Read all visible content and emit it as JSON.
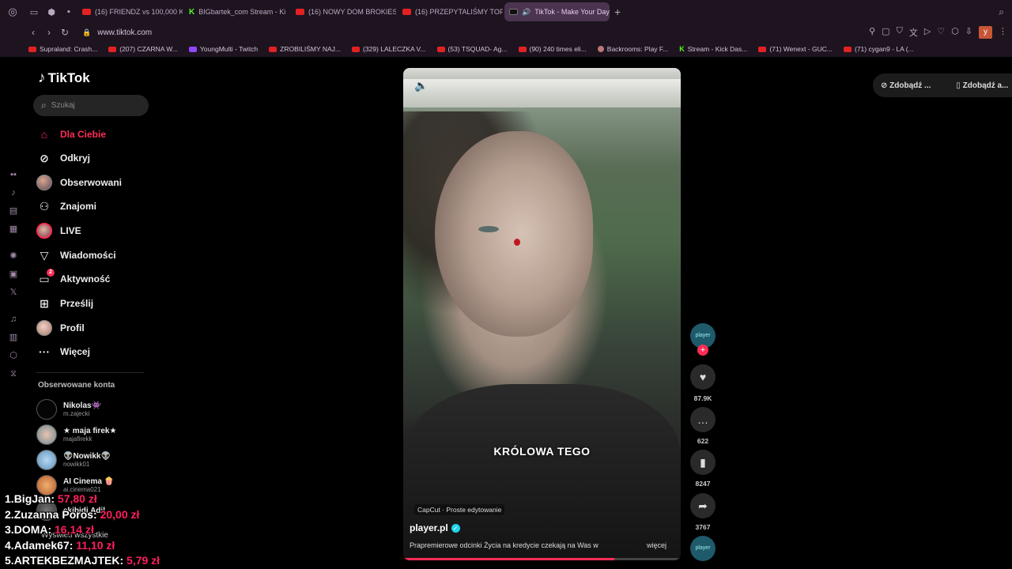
{
  "browser": {
    "tabs": [
      {
        "label": "(16) FRIENDZ vs 100,000 K",
        "icon": "youtube",
        "active": false
      },
      {
        "label": "BIGbartek_com Stream - Ki",
        "icon": "kick",
        "active": false
      },
      {
        "label": "(16) NOWY DOM BROKIES",
        "icon": "youtube",
        "active": false
      },
      {
        "label": "(16) PRZEPYTALIŚMY TOP",
        "icon": "youtube",
        "active": false
      },
      {
        "label": "TikTok - Make Your Day",
        "icon": "tiktok",
        "active": true
      }
    ],
    "url": "www.tiktok.com",
    "profile_initial": "y",
    "bookmarks": [
      {
        "label": "Supraland: Crash...",
        "icon": "youtube"
      },
      {
        "label": "(207) CZARNA W...",
        "icon": "youtube"
      },
      {
        "label": "YoungMulti - Twitch",
        "icon": "twitch"
      },
      {
        "label": "ZROBILIŚMY NAJ...",
        "icon": "youtube"
      },
      {
        "label": "(329) LALECZKA V...",
        "icon": "youtube"
      },
      {
        "label": "(53) TSQUAD- Ag...",
        "icon": "youtube"
      },
      {
        "label": "(90) 240 times eli...",
        "icon": "youtube"
      },
      {
        "label": "Backrooms: Play F...",
        "icon": "backrooms"
      },
      {
        "label": "Stream - Kick Das...",
        "icon": "kick"
      },
      {
        "label": "(71) Wenext - GUC...",
        "icon": "youtube"
      },
      {
        "label": "(71) cygan9 - LA (...",
        "icon": "youtube"
      }
    ]
  },
  "tiktok": {
    "logo": "TikTok",
    "search_placeholder": "Szukaj",
    "nav": [
      {
        "label": "Dla Ciebie",
        "icon": "home-icon",
        "active": true
      },
      {
        "label": "Odkryj",
        "icon": "compass-icon"
      },
      {
        "label": "Obserwowani",
        "icon": "avatar"
      },
      {
        "label": "Znajomi",
        "icon": "friends-icon"
      },
      {
        "label": "LIVE",
        "icon": "live-avatar"
      },
      {
        "label": "Wiadomości",
        "icon": "messages-icon"
      },
      {
        "label": "Aktywność",
        "icon": "activity-icon",
        "badge": "2"
      },
      {
        "label": "Prześlij",
        "icon": "upload-icon"
      },
      {
        "label": "Profil",
        "icon": "profile-avatar"
      },
      {
        "label": "Więcej",
        "icon": "more-icon"
      }
    ],
    "following_title": "Obserwowane konta",
    "following": [
      {
        "name": "Nikolas👾",
        "user": "m.zajecki"
      },
      {
        "name": "★ maja firek★",
        "user": "majafirekk"
      },
      {
        "name": "👽Nowikk👽",
        "user": "nowikk01"
      },
      {
        "name": "AI Cinema 🍿",
        "user": "ai.cinema021"
      },
      {
        "name": "skibidi Adil",
        "user": ""
      }
    ],
    "see_all": "Wyświetl wszystkie",
    "get_app": [
      "Zdobądź ...",
      "Zdobądź a..."
    ]
  },
  "video": {
    "caption": "KRÓLOWA TEGO",
    "capcut": "CapCut · Proste edytowanie",
    "author": "player.pl",
    "description": "Prapremierowe odcinki Życia na kredycie czekają na Was w",
    "more": "więcej",
    "progress": 0.76,
    "likes": "87.9K",
    "comments": "622",
    "saves": "8247",
    "shares": "3767",
    "avatar_text": "player"
  },
  "donations": [
    {
      "rank": "1.",
      "name": "BigJan:",
      "amount": "57,80 zł"
    },
    {
      "rank": "2.",
      "name": "Zuzanna Poros:",
      "amount": "20,00 zł"
    },
    {
      "rank": "3.",
      "name": "DOMA:",
      "amount": "16,14 zł"
    },
    {
      "rank": "4.",
      "name": "Adamek67:",
      "amount": "11,10 zł"
    },
    {
      "rank": "5.",
      "name": "ARTEKBEZMAJTEK:",
      "amount": "5,79 zł"
    }
  ],
  "colors": {
    "accent": "#fe2c55",
    "donation_amount": "#ff1e5c",
    "browser_bg": "#1d1420"
  }
}
